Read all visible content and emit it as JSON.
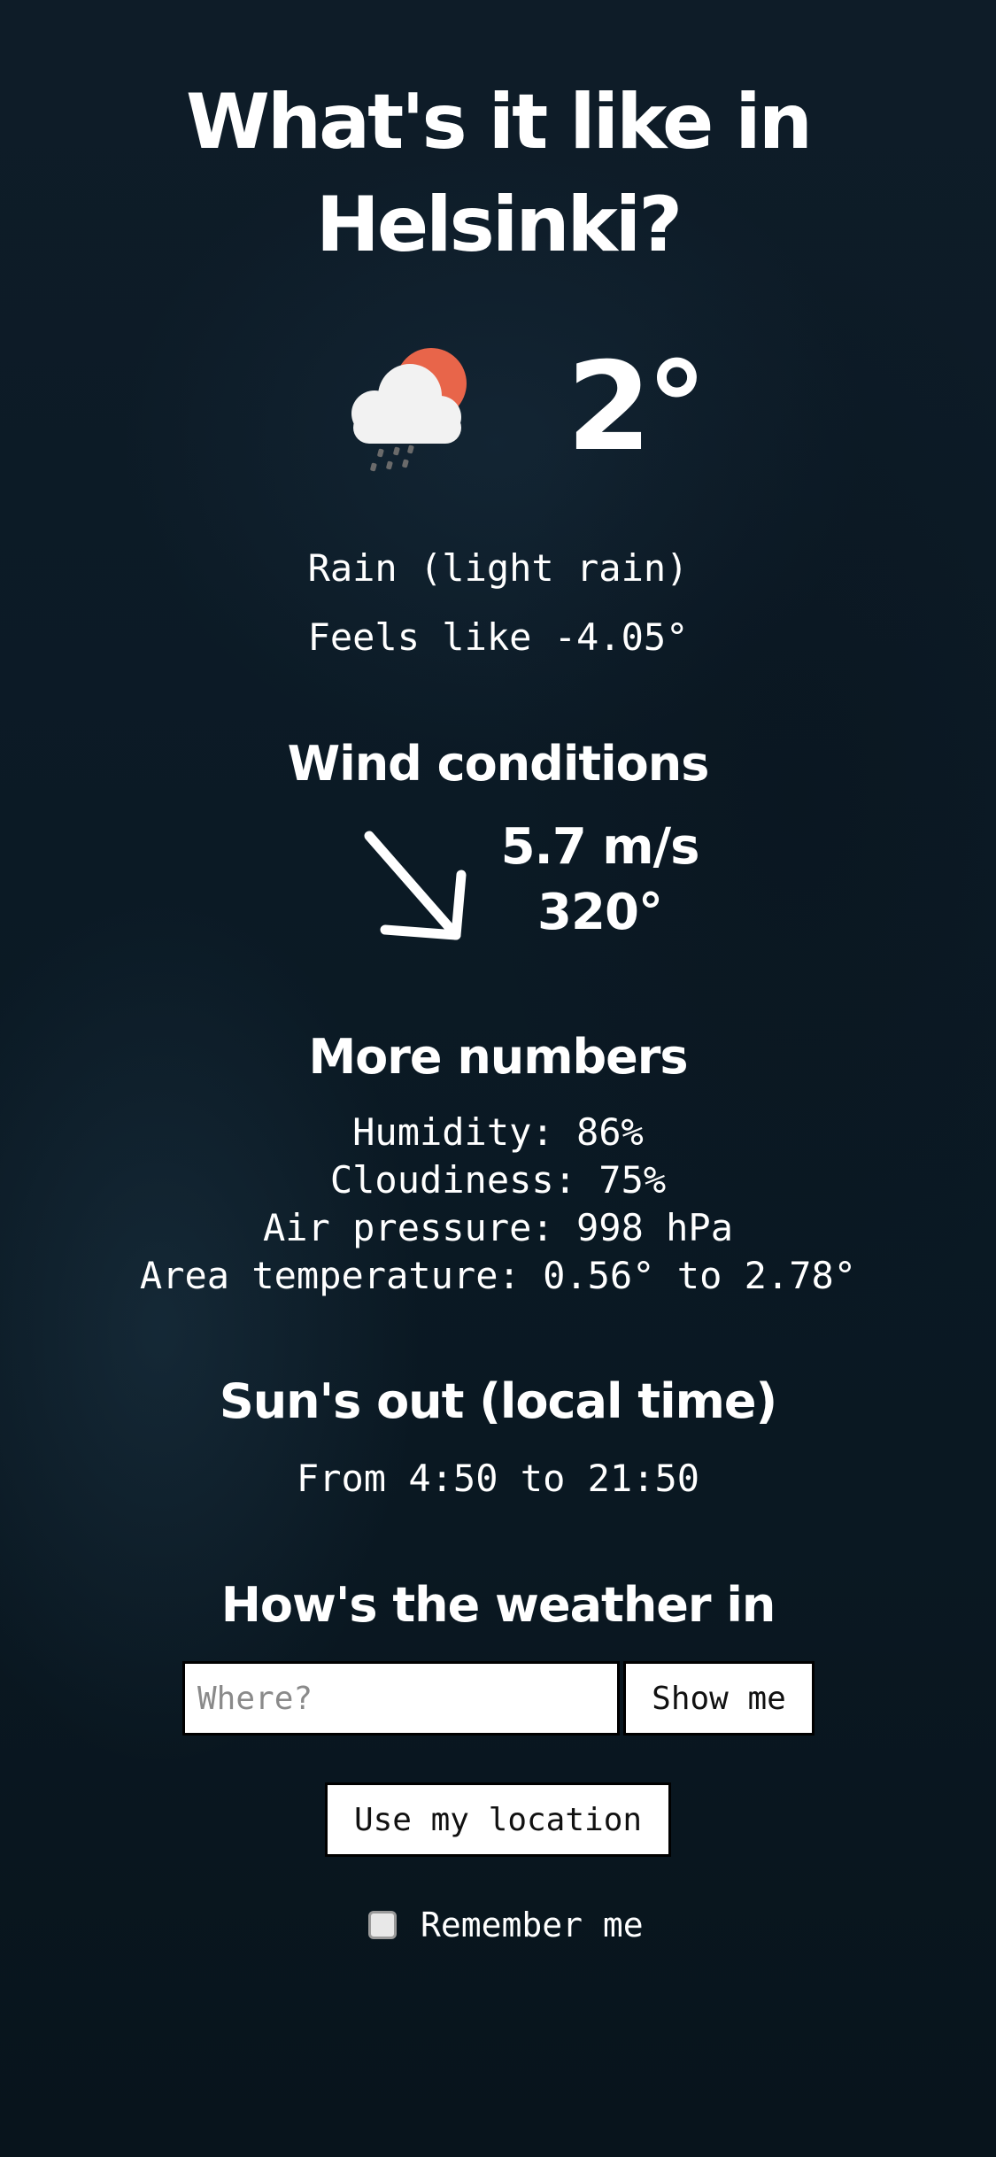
{
  "page": {
    "title": "What's it like in Helsinki?",
    "title_line1": "What's it like in",
    "title_line2": "Helsinki?"
  },
  "current": {
    "icon": "cloud-sun-rain-icon",
    "temperature": "2°",
    "condition": "Rain (light rain)",
    "feels_like": "Feels like -4.05°"
  },
  "wind": {
    "heading": "Wind conditions",
    "icon": "wind-direction-arrow-icon",
    "speed": "5.7 m/s",
    "direction": "320°",
    "direction_degrees": 320
  },
  "more": {
    "heading": "More numbers",
    "humidity": "Humidity: 86%",
    "cloudiness": "Cloudiness: 75%",
    "pressure": "Air pressure: 998 hPa",
    "area_temperature": "Area temperature: 0.56° to 2.78°"
  },
  "sun": {
    "heading": "Sun's out (local time)",
    "range": "From 4:50 to 21:50"
  },
  "search": {
    "heading": "How's the weather in",
    "placeholder": "Where?",
    "value": "",
    "submit_label": "Show me",
    "location_label": "Use my location",
    "remember_label": "Remember me",
    "remember_checked": false
  },
  "colors": {
    "background": "#0b1a25",
    "text": "#ffffff",
    "sun": "#e8654a",
    "cloud": "#f2f2f2",
    "rain": "#555555"
  }
}
